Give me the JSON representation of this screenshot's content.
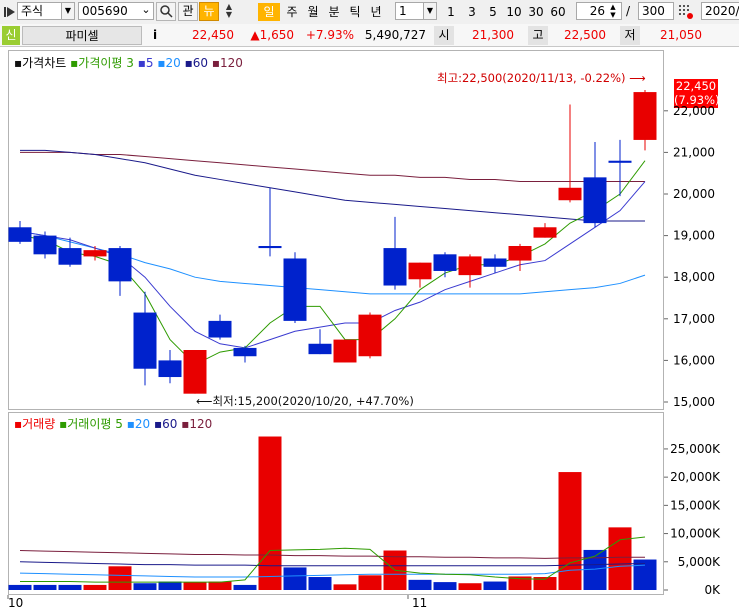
{
  "toolbar": {
    "market_icon": "play-triangle-icon",
    "market_value": "주식",
    "code_value": "005690",
    "view_label": "관",
    "news_label": "뉴",
    "period_buttons": [
      "일",
      "주",
      "월",
      "분",
      "틱",
      "년"
    ],
    "interval_value": "1",
    "quick_intervals": [
      "1",
      "3",
      "5",
      "10",
      "30",
      "60"
    ],
    "display_count": "26",
    "separator": "/",
    "total_count": "300",
    "date_value": "2020/1"
  },
  "quote": {
    "credit_label": "신",
    "name": "파미셀",
    "info_label": "i",
    "price": "22,450",
    "change": "▲1,650",
    "change_pct": "+7.93%",
    "volume": "5,490,727",
    "open_label": "시",
    "open_value": "21,300",
    "high_label": "고",
    "high_value": "22,500",
    "low_label": "저",
    "low_value": "21,050"
  },
  "price_panel": {
    "legend_title": "가격차트",
    "legend_ma": "가격이평",
    "ma_periods": [
      "3",
      "5",
      "20",
      "60",
      "120"
    ],
    "high_annotation": "최고:22,500(2020/11/13, -0.22%)",
    "low_annotation": "최저:15,200(2020/10/20, +47.70%)",
    "last_price_tag": "22,450",
    "last_pct_tag": "(7.93%)"
  },
  "volume_panel": {
    "legend_title": "거래량",
    "legend_ma": "거래이평",
    "ma_periods": [
      "5",
      "20",
      "60",
      "120"
    ]
  },
  "x_labels": [
    "10",
    "11"
  ],
  "colors": {
    "up": "#e80000",
    "down": "#0022cc",
    "ma3": "#2e9b00",
    "ma5": "#3a3ad0",
    "ma20": "#1e90ff",
    "ma60": "#1a1a8a",
    "ma120": "#7a1f3d",
    "tag_bg": "#ff0000"
  },
  "chart_data": [
    {
      "type": "candlestick",
      "title": "가격차트",
      "y_ticks": [
        "22,000",
        "21,000",
        "20,000",
        "19,000",
        "18,000",
        "17,000",
        "16,000",
        "15,000"
      ],
      "ylim": [
        15000,
        22600
      ],
      "candles": [
        {
          "o": 19200,
          "h": 19350,
          "l": 18800,
          "c": 18850
        },
        {
          "o": 19000,
          "h": 19100,
          "l": 18450,
          "c": 18550
        },
        {
          "o": 18700,
          "h": 18950,
          "l": 18250,
          "c": 18300
        },
        {
          "o": 18500,
          "h": 18750,
          "l": 18400,
          "c": 18650
        },
        {
          "o": 18700,
          "h": 18750,
          "l": 17550,
          "c": 17900
        },
        {
          "o": 17150,
          "h": 17650,
          "l": 15400,
          "c": 15800
        },
        {
          "o": 16000,
          "h": 16250,
          "l": 15450,
          "c": 15600
        },
        {
          "o": 15200,
          "h": 16250,
          "l": 15200,
          "c": 16250
        },
        {
          "o": 16950,
          "h": 17100,
          "l": 16500,
          "c": 16550
        },
        {
          "o": 16300,
          "h": 16350,
          "l": 15950,
          "c": 16100
        },
        {
          "o": 18750,
          "h": 20150,
          "l": 18500,
          "c": 18700
        },
        {
          "o": 18450,
          "h": 18600,
          "l": 16900,
          "c": 16950
        },
        {
          "o": 16400,
          "h": 16750,
          "l": 16150,
          "c": 16150
        },
        {
          "o": 15950,
          "h": 16500,
          "l": 15950,
          "c": 16500
        },
        {
          "o": 16100,
          "h": 17150,
          "l": 16050,
          "c": 17100
        },
        {
          "o": 18700,
          "h": 19450,
          "l": 17700,
          "c": 17800
        },
        {
          "o": 17950,
          "h": 18350,
          "l": 17750,
          "c": 18350
        },
        {
          "o": 18550,
          "h": 18600,
          "l": 18000,
          "c": 18150
        },
        {
          "o": 18050,
          "h": 18550,
          "l": 17750,
          "c": 18500
        },
        {
          "o": 18450,
          "h": 18550,
          "l": 18100,
          "c": 18250
        },
        {
          "o": 18400,
          "h": 18800,
          "l": 18150,
          "c": 18750
        },
        {
          "o": 18950,
          "h": 19300,
          "l": 18950,
          "c": 19200
        },
        {
          "o": 19850,
          "h": 22150,
          "l": 19800,
          "c": 20150
        },
        {
          "o": 20400,
          "h": 21250,
          "l": 19200,
          "c": 19300
        },
        {
          "o": 20800,
          "h": 21300,
          "l": 19950,
          "c": 20750
        },
        {
          "o": 21300,
          "h": 22500,
          "l": 21050,
          "c": 22450
        }
      ],
      "ma3": [
        19000,
        18900,
        18600,
        18500,
        18300,
        17600,
        16500,
        15900,
        16200,
        16300,
        16900,
        17300,
        17300,
        16500,
        16500,
        17000,
        17700,
        18100,
        18300,
        18300,
        18500,
        18800,
        19300,
        19600,
        20000,
        20800
      ],
      "ma5": [
        19100,
        19000,
        18900,
        18700,
        18500,
        18000,
        17300,
        16700,
        16400,
        16300,
        16500,
        16700,
        16800,
        16900,
        16900,
        17200,
        17400,
        17700,
        17900,
        18100,
        18300,
        18400,
        18800,
        19200,
        19600,
        20300
      ],
      "ma20": [
        19100,
        19000,
        18850,
        18700,
        18550,
        18350,
        18200,
        18000,
        17900,
        17850,
        17800,
        17750,
        17700,
        17650,
        17600,
        17600,
        17600,
        17600,
        17600,
        17600,
        17600,
        17650,
        17700,
        17750,
        17850,
        18050
      ],
      "ma60": [
        21050,
        21050,
        21000,
        20950,
        20850,
        20750,
        20600,
        20450,
        20350,
        20250,
        20150,
        20050,
        19950,
        19850,
        19800,
        19750,
        19700,
        19650,
        19600,
        19550,
        19500,
        19450,
        19400,
        19350,
        19350,
        19350
      ],
      "ma120": [
        21000,
        21000,
        21000,
        20950,
        20950,
        20900,
        20850,
        20800,
        20750,
        20700,
        20650,
        20600,
        20550,
        20500,
        20450,
        20450,
        20400,
        20400,
        20350,
        20350,
        20300,
        20300,
        20300,
        20300,
        20300,
        20300
      ]
    },
    {
      "type": "bar",
      "title": "거래량",
      "y_ticks": [
        "25,000K",
        "20,000K",
        "15,000K",
        "10,000K",
        "5,000K",
        "0K"
      ],
      "ylim": [
        0,
        28000
      ],
      "values": [
        900,
        900,
        900,
        900,
        4200,
        1200,
        1500,
        1400,
        1500,
        900,
        27200,
        4000,
        2300,
        1000,
        2600,
        7000,
        1800,
        1400,
        1200,
        1500,
        2400,
        2300,
        20900,
        7100,
        11100,
        5400
      ],
      "up": [
        false,
        false,
        false,
        true,
        true,
        false,
        false,
        true,
        true,
        false,
        true,
        false,
        false,
        true,
        true,
        true,
        false,
        false,
        true,
        false,
        true,
        true,
        true,
        false,
        true,
        false
      ],
      "ma5": [
        1500,
        1500,
        1500,
        1400,
        1400,
        1400,
        1400,
        1400,
        1400,
        1800,
        7000,
        7100,
        7200,
        7400,
        7200,
        3500,
        3000,
        2800,
        2700,
        2300,
        2000,
        1900,
        4800,
        6000,
        8900,
        9400
      ],
      "ma20": [
        3000,
        2900,
        2800,
        2700,
        2600,
        2500,
        2400,
        2300,
        2300,
        2300,
        2400,
        2500,
        2600,
        2700,
        2800,
        2800,
        2800,
        2800,
        2800,
        2800,
        2800,
        2900,
        3500,
        3700,
        4200,
        4400
      ],
      "ma60": [
        5000,
        4900,
        4800,
        4700,
        4600,
        4500,
        4500,
        4400,
        4400,
        4400,
        4300,
        4300,
        4300,
        4300,
        4300,
        4300,
        4300,
        4300,
        4300,
        4300,
        4300,
        4300,
        4400,
        4500,
        4600,
        4700
      ],
      "ma120": [
        7000,
        6900,
        6800,
        6700,
        6600,
        6500,
        6400,
        6300,
        6300,
        6200,
        6200,
        6100,
        6100,
        6000,
        6000,
        5900,
        5900,
        5800,
        5800,
        5700,
        5700,
        5600,
        5700,
        5700,
        5800,
        5800
      ]
    }
  ]
}
